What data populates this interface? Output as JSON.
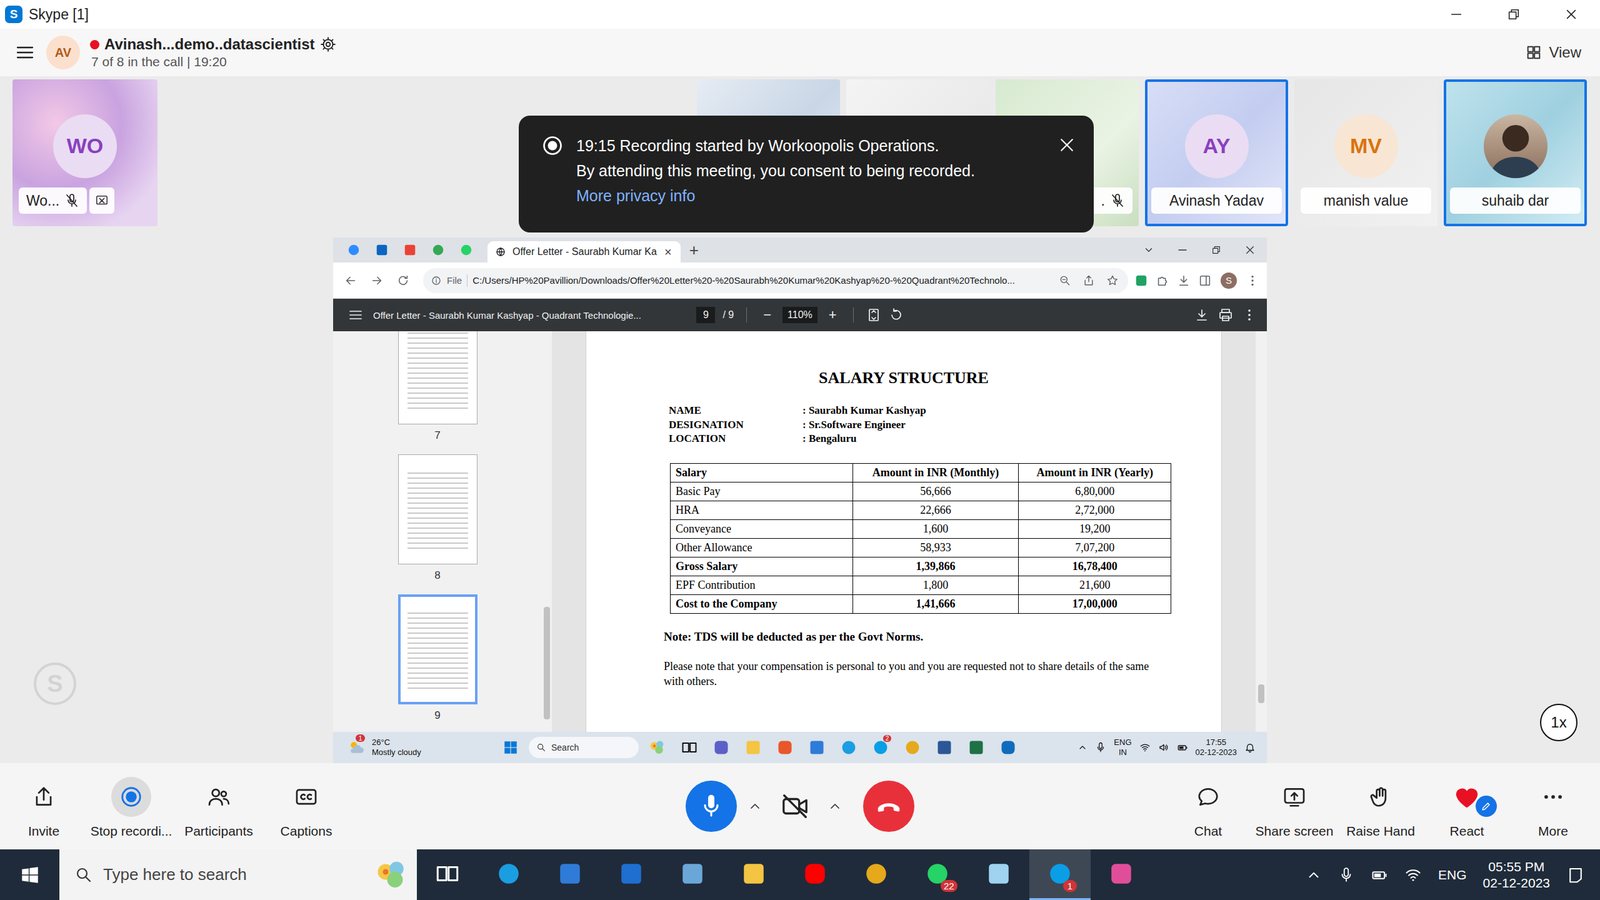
{
  "window": {
    "title": "Skype [1]",
    "logo": "S"
  },
  "call": {
    "avatar": "AV",
    "recording": true,
    "title": "Avinash...demo..datascientist",
    "subtitle": "7 of 8 in the call | 19:20",
    "view": "View"
  },
  "participants": [
    {
      "kind": "avatar",
      "initials": "WO",
      "name": "Wo...",
      "muted": true,
      "sharing": true,
      "highlighted": false,
      "color": "#8a3fbf"
    },
    {
      "kind": "blank",
      "highlighted": false
    },
    {
      "kind": "blank",
      "highlighted": false
    },
    {
      "kind": "label",
      "name": ".",
      "muted": true,
      "highlighted": false
    },
    {
      "kind": "avatar",
      "initials": "AY",
      "name": "Avinash Yadav",
      "highlighted": true,
      "color": "#8a3fbf"
    },
    {
      "kind": "avatar",
      "initials": "MV",
      "name": "manish value",
      "highlighted": false,
      "color": "#d9730d"
    },
    {
      "kind": "photo",
      "name": "suhaib dar",
      "highlighted": true
    }
  ],
  "notification": {
    "lines": [
      "19:15 Recording started by Workoopolis Operations.",
      "By attending this meeting, you consent to being recorded."
    ],
    "link": "More privacy info"
  },
  "shared_screen": {
    "browser": {
      "tabs": [
        {
          "label": "Offer Letter - Saurabh Kumar Ka",
          "close": "×",
          "selected": true
        }
      ],
      "new_tab": "+",
      "scheme": "File",
      "url": "C:/Users/HP%20Pavillion/Downloads/Offer%20Letter%20-%20Saurabh%20Kumar%20Kashyap%20-%20Quadrant%20Technolo...",
      "profile": "S"
    },
    "pdf": {
      "title": "Offer Letter - Saurabh Kumar Kashyap - Quadrant Technologie...",
      "page": "9",
      "pages": "/ 9",
      "zoom_out": "−",
      "zoom": "110%",
      "zoom_in": "+",
      "thumbnails": [
        {
          "label": "7",
          "selected": false
        },
        {
          "label": "8",
          "selected": false
        },
        {
          "label": "9",
          "selected": true
        }
      ]
    },
    "document": {
      "heading": "SALARY STRUCTURE",
      "fields": [
        {
          "label": "NAME",
          "value": ": Saurabh Kumar Kashyap"
        },
        {
          "label": "DESIGNATION",
          "value": ": Sr.Software Engineer"
        },
        {
          "label": "LOCATION",
          "value": ": Bengaluru"
        }
      ],
      "table": {
        "columns": [
          "Salary",
          "Amount in INR (Monthly)",
          "Amount in INR (Yearly)"
        ],
        "rows": [
          {
            "cells": [
              "Basic Pay",
              "56,666",
              "6,80,000"
            ],
            "bold": false
          },
          {
            "cells": [
              "HRA",
              "22,666",
              "2,72,000"
            ],
            "bold": false
          },
          {
            "cells": [
              "Conveyance",
              "1,600",
              "19,200"
            ],
            "bold": false
          },
          {
            "cells": [
              "Other Allowance",
              "58,933",
              "7,07,200"
            ],
            "bold": false
          },
          {
            "cells": [
              "Gross Salary",
              "1,39,866",
              "16,78,400"
            ],
            "bold": true
          },
          {
            "cells": [
              "EPF Contribution",
              "1,800",
              "21,600"
            ],
            "bold": false
          },
          {
            "cells": [
              "Cost to the Company",
              "1,41,666",
              "17,00,000"
            ],
            "bold": true
          }
        ]
      },
      "note": "Note: TDS will be deducted as per the Govt Norms.",
      "paragraph": "Please note that your compensation is personal to you and you are requested not to share details of the same with others."
    },
    "taskbar": {
      "weather_temp": "26°C",
      "weather_desc": "Mostly cloudy",
      "weather_badge": "1",
      "search": "Search",
      "skype_badge": "2",
      "lang": "ENG",
      "region": "IN",
      "time": "17:55",
      "date": "02-12-2023"
    }
  },
  "toolbar": {
    "left": [
      {
        "label": "Invite",
        "active": false
      },
      {
        "label": "Stop recordi...",
        "active": true
      },
      {
        "label": "Participants",
        "active": false
      },
      {
        "label": "Captions",
        "active": false
      }
    ],
    "mic_on": true,
    "camera_on": false,
    "right": [
      {
        "label": "Chat"
      },
      {
        "label": "Share screen"
      },
      {
        "label": "Raise Hand"
      },
      {
        "label": "React"
      },
      {
        "label": "More"
      }
    ]
  },
  "playback_speed": "1x",
  "taskbar": {
    "search": "Type here to search",
    "whatsapp_badge": "22",
    "skype_badge": "1",
    "skype_active": true,
    "lang": "ENG",
    "time": "05:55 PM",
    "date": "02-12-2023"
  }
}
